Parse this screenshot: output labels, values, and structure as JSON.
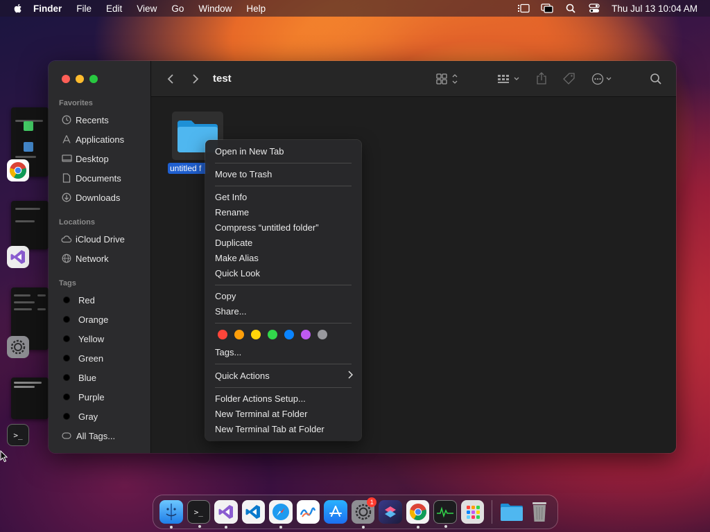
{
  "menubar": {
    "app_name": "Finder",
    "items": [
      "File",
      "Edit",
      "View",
      "Go",
      "Window",
      "Help"
    ],
    "clock": "Thu Jul 13  10:04 AM"
  },
  "finder": {
    "title": "test",
    "sidebar": {
      "favorites_header": "Favorites",
      "favorites": [
        {
          "label": "Recents",
          "icon": "clock-icon"
        },
        {
          "label": "Applications",
          "icon": "applications-icon"
        },
        {
          "label": "Desktop",
          "icon": "desktop-icon"
        },
        {
          "label": "Documents",
          "icon": "document-icon"
        },
        {
          "label": "Downloads",
          "icon": "download-icon"
        }
      ],
      "locations_header": "Locations",
      "locations": [
        {
          "label": "iCloud Drive",
          "icon": "cloud-icon"
        },
        {
          "label": "Network",
          "icon": "globe-icon"
        }
      ],
      "tags_header": "Tags",
      "tags": [
        "Red",
        "Orange",
        "Yellow",
        "Green",
        "Blue",
        "Purple",
        "Gray"
      ],
      "all_tags": "All Tags..."
    },
    "folder": {
      "label": "untitled f"
    }
  },
  "context_menu": {
    "open_new_tab": "Open in New Tab",
    "move_to_trash": "Move to Trash",
    "get_info": "Get Info",
    "rename": "Rename",
    "compress": "Compress “untitled folder”",
    "duplicate": "Duplicate",
    "make_alias": "Make Alias",
    "quick_look": "Quick Look",
    "copy": "Copy",
    "share": "Share...",
    "tag_colors": [
      "#ff453a",
      "#ff9f0a",
      "#ffd60a",
      "#32d74b",
      "#0a84ff",
      "#bf5af2",
      "#98989d"
    ],
    "tags": "Tags...",
    "quick_actions": "Quick Actions",
    "folder_actions_setup": "Folder Actions Setup...",
    "new_terminal": "New Terminal at Folder",
    "new_terminal_tab": "New Terminal Tab at Folder"
  },
  "dock": {
    "apps": [
      "finder",
      "terminal",
      "visual-studio",
      "vscode",
      "safari",
      "freeform",
      "app-store",
      "system-settings",
      "shortcuts",
      "chrome",
      "activity-monitor",
      "launchpad",
      "folder",
      "trash"
    ],
    "settings_badge": "1"
  }
}
